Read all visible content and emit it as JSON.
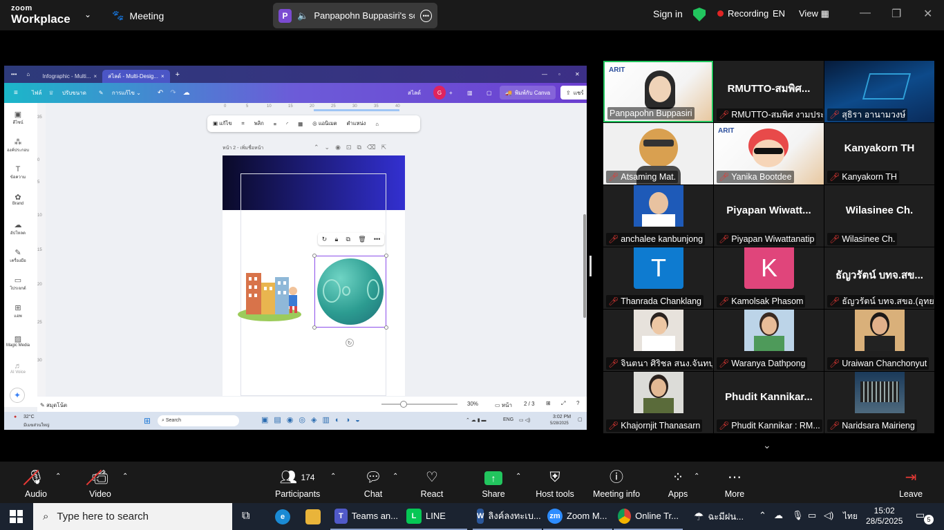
{
  "topbar": {
    "brand_line1": "zoom",
    "brand_line2": "Workplace",
    "meeting_label": "Meeting",
    "share_badge": "P",
    "share_label": "Panpapohn Buppasiri's scree",
    "sign_in": "Sign in",
    "recording": "Recording",
    "language": "EN",
    "view": "View"
  },
  "shared_screen": {
    "browser_tabs": [
      "Infographic - Multi...",
      "สไลด์ - Multi-Desig..."
    ],
    "canva_menu": [
      "ไฟล์",
      "ปรับขนาด",
      "การแก้ไข"
    ],
    "canva_title": "สไลด์",
    "canva_user": "G",
    "print_label": "พิมพ์กับ Canva",
    "share_label": "แชร์",
    "rail": [
      "ดีไซน์",
      "องค์ประกอบ",
      "ข้อความ",
      "Brand",
      "อัปโหลด",
      "เครื่องมือ",
      "โปรเจกต์",
      "แอพ",
      "Magic Media",
      "AI Voice"
    ],
    "toolbar": [
      "แก้ไข",
      "พลิก",
      "แอนิเมต",
      "ตำแหน่ง"
    ],
    "page_header": "หน้า 2 - เพิ่มชื่อหน้า",
    "ruler_marks": [
      "0",
      "5",
      "10",
      "15",
      "20",
      "25",
      "30",
      "35",
      "40"
    ],
    "ruler_v_marks": [
      "35",
      "0",
      "5",
      "10",
      "15",
      "20",
      "25",
      "30"
    ],
    "notes": "สมุดโน้ต",
    "zoom": "30%",
    "page_label": "หน้า",
    "page_count": "2 / 3",
    "weather_temp": "32°C",
    "weather_desc": "มีเมฆส่วนใหญ่",
    "search": "Search",
    "lang": "ENG",
    "time": "3:02 PM",
    "date": "5/28/2025"
  },
  "gallery": {
    "tiles": [
      {
        "big": "",
        "label": "Panpapohn Buppasiri",
        "muted": false
      },
      {
        "big": "RMUTTO-สมพิศ...",
        "label": "RMUTTO-สมพิศ งามประ...",
        "muted": true
      },
      {
        "big": "",
        "label": "สุธิรา อานามวงษ์",
        "muted": true
      },
      {
        "big": "",
        "label": "Atsaming Mat.",
        "muted": true
      },
      {
        "big": "",
        "label": "Yanika Bootdee",
        "muted": true
      },
      {
        "big": "Kanyakorn TH",
        "label": "Kanyakorn TH",
        "muted": true
      },
      {
        "big": "",
        "label": "anchalee kanbunjong",
        "muted": true
      },
      {
        "big": "Piyapan  Wiwatt...",
        "label": "Piyapan Wiwattanatip",
        "muted": true
      },
      {
        "big": "Wilasinee Ch.",
        "label": "Wilasinee Ch.",
        "muted": true
      },
      {
        "big": "T",
        "label": "Thanrada Chanklang",
        "muted": true
      },
      {
        "big": "K",
        "label": "Kamolsak Phasom",
        "muted": true
      },
      {
        "big": "ธัญวรัตน์ บทจ.สข...",
        "label": "ธัญวรัตน์ บทจ.สขอ.(อุทย...",
        "muted": true
      },
      {
        "big": "",
        "label": "จินตนา ศิริชล สนง.จันทบุรี",
        "muted": true
      },
      {
        "big": "",
        "label": "Waranya Dathpong",
        "muted": true
      },
      {
        "big": "",
        "label": "Uraiwan Chanchonyut",
        "muted": true
      },
      {
        "big": "",
        "label": "Khajornjit Thanasarn",
        "muted": true
      },
      {
        "big": "Phudit  Kannikar...",
        "label": "Phudit Kannikar : RM...",
        "muted": true
      },
      {
        "big": "",
        "label": "Naridsara Mairieng",
        "muted": true
      }
    ]
  },
  "controls": {
    "audio": "Audio",
    "video": "Video",
    "participants_count": "174",
    "participants": "Participants",
    "chat": "Chat",
    "react": "React",
    "share": "Share",
    "host_tools": "Host tools",
    "meeting_info": "Meeting info",
    "apps": "Apps",
    "more": "More",
    "leave": "Leave"
  },
  "taskbar": {
    "search_placeholder": "Type here to search",
    "apps": [
      "Teams an...",
      "LINE",
      "ลิงค์ลงทะเบ...",
      "Zoom M...",
      "Online Tr...",
      "ฉะมีฝน..."
    ],
    "lang": "ไทย",
    "time": "15:02",
    "date": "28/5/2025",
    "notifications": "5"
  },
  "colors": {
    "recording_dot": "#e02424",
    "active_speaker": "#22c55e",
    "muted_icon": "#e53935",
    "share_green": "#22c55e"
  }
}
